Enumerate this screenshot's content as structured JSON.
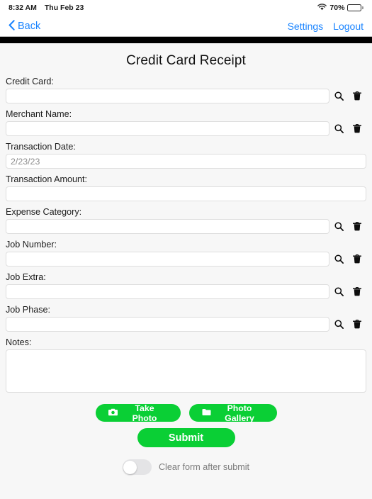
{
  "status_bar": {
    "time": "8:32 AM",
    "date": "Thu Feb 23",
    "battery_percent": "70%",
    "battery_level": 70,
    "wifi_icon": "wifi-icon",
    "battery_icon": "battery-icon"
  },
  "nav": {
    "back_label": "Back",
    "back_icon": "chevron-left-icon",
    "settings_label": "Settings",
    "logout_label": "Logout",
    "link_color": "#1a84ff"
  },
  "page": {
    "title": "Credit Card Receipt",
    "background": "#f7f7f7"
  },
  "fields": [
    {
      "label": "Credit Card:",
      "value": "",
      "placeholder": "",
      "name": "credit-card",
      "has_icons": true
    },
    {
      "label": "Merchant Name:",
      "value": "",
      "placeholder": "",
      "name": "merchant-name",
      "has_icons": true
    },
    {
      "label": "Transaction Date:",
      "value": "2/23/23",
      "placeholder": "",
      "name": "transaction-date",
      "has_icons": false
    },
    {
      "label": "Transaction Amount:",
      "value": "",
      "placeholder": "",
      "name": "transaction-amount",
      "has_icons": false
    },
    {
      "label": "Expense Category:",
      "value": "",
      "placeholder": "",
      "name": "expense-category",
      "has_icons": true
    },
    {
      "label": "Job Number:",
      "value": "",
      "placeholder": "",
      "name": "job-number",
      "has_icons": true
    },
    {
      "label": "Job Extra:",
      "value": "",
      "placeholder": "",
      "name": "job-extra",
      "has_icons": true
    },
    {
      "label": "Job Phase:",
      "value": "",
      "placeholder": "",
      "name": "job-phase",
      "has_icons": true
    }
  ],
  "icons": {
    "search": "search-icon",
    "delete": "trash-icon",
    "camera": "camera-icon",
    "folder": "folder-icon"
  },
  "notes": {
    "label": "Notes:",
    "value": "",
    "placeholder": ""
  },
  "actions": {
    "take_photo_label": "Take Photo",
    "photo_gallery_label": "Photo Gallery",
    "submit_label": "Submit",
    "green": "#0ACF35"
  },
  "toggle": {
    "label": "Clear form after submit",
    "on": false
  }
}
